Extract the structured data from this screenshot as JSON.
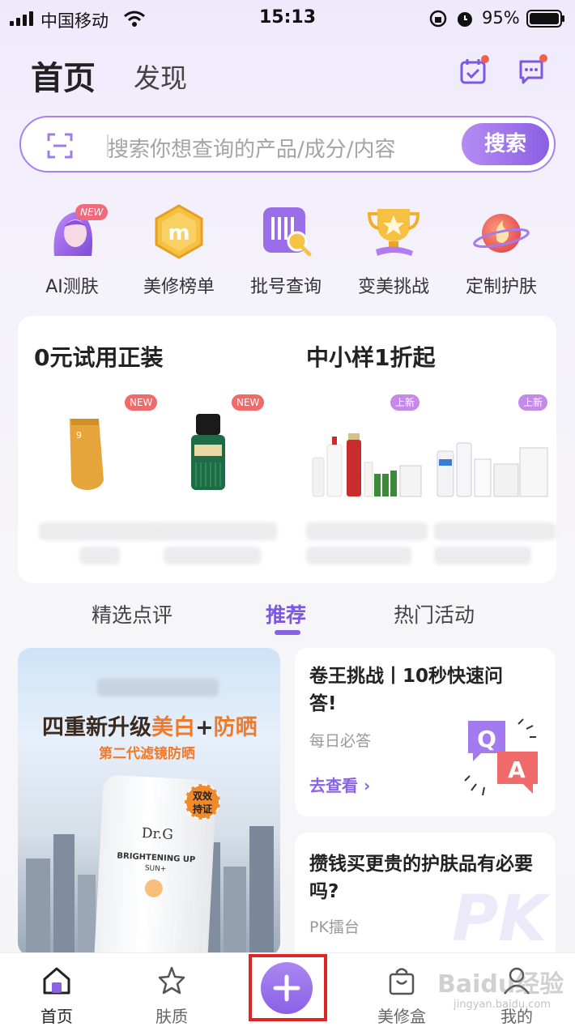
{
  "status_bar": {
    "carrier": "中国移动",
    "time": "15:13",
    "battery": "95%"
  },
  "header": {
    "tab_home": "首页",
    "tab_discover": "发现"
  },
  "search": {
    "placeholder": "搜索你想查询的产品/成分/内容",
    "button": "搜索"
  },
  "quick_actions": [
    {
      "label": "AI测肤",
      "badge": "NEW"
    },
    {
      "label": "美修榜单",
      "icon_text": "m"
    },
    {
      "label": "批号查询"
    },
    {
      "label": "变美挑战"
    },
    {
      "label": "定制护肤"
    }
  ],
  "promo": {
    "left_title": "0元试用正装",
    "right_title": "中小样1折起",
    "badges": [
      "NEW",
      "NEW",
      "上新",
      "上新"
    ]
  },
  "feed_tabs": [
    "精选点评",
    "推荐",
    "热门活动"
  ],
  "banner": {
    "headline_part1": "四重新升级",
    "headline_part2": "美白",
    "headline_part3": "+",
    "headline_part4": "防晒",
    "subline": "第二代滤镜防晒",
    "product_brand": "Dr.G",
    "product_name": "BRIGHTENING UP",
    "product_sub": "SUN+",
    "seal_line1": "双效",
    "seal_line2": "持证"
  },
  "card_quiz": {
    "title": "卷王挑战丨10秒快速问答!",
    "subtitle": "每日必答",
    "link": "去查看 ›"
  },
  "card_pk": {
    "title": "攒钱买更贵的护肤品有必要吗?",
    "subtitle": "PK擂台",
    "watermark": "PK"
  },
  "bottom_nav": [
    {
      "label": "首页"
    },
    {
      "label": "肤质"
    },
    {
      "label": "美修盒"
    },
    {
      "label": "我的"
    }
  ],
  "watermark": {
    "main": "Baidu经验",
    "url": "jingyan.baidu.com"
  },
  "colors": {
    "accent": "#8a62e8",
    "highlight_orange": "#f07a2a",
    "red_badge": "#f0604a"
  }
}
